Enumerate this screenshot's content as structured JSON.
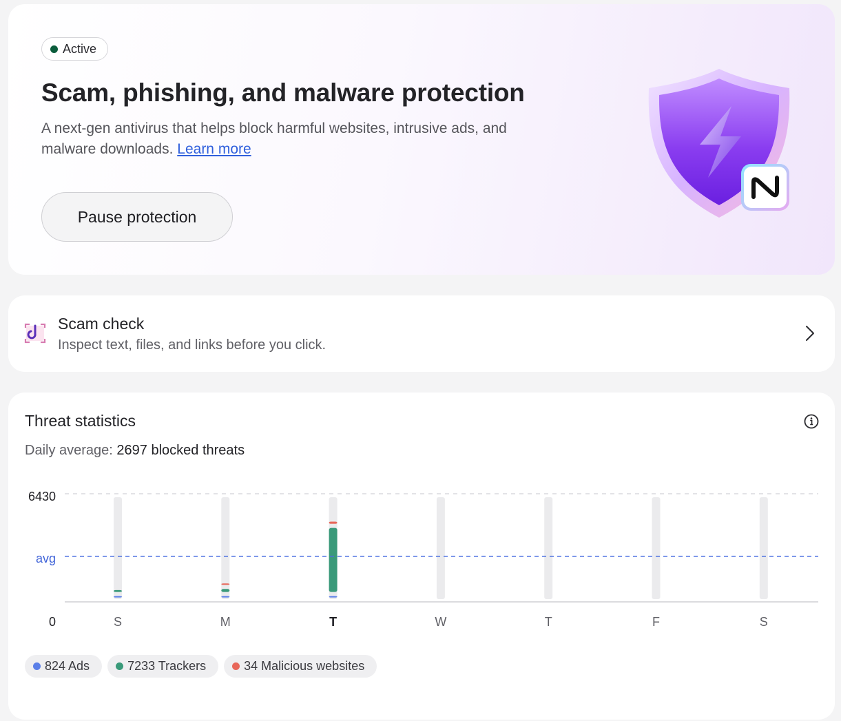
{
  "hero": {
    "status": "Active",
    "status_color": "#0b5d3c",
    "title": "Scam, phishing, and malware protection",
    "description": "A next-gen antivirus that helps block harmful websites, intrusive ads, and malware downloads.",
    "learn_more": "Learn more",
    "pause_button": "Pause protection",
    "shield_icon": "shield-lightning-icon",
    "badge_icon": "nordvpn-logo-icon"
  },
  "scam_check": {
    "title": "Scam check",
    "subtitle": "Inspect text, files, and links before you click.",
    "icon": "scan-hook-icon"
  },
  "threats": {
    "title": "Threat statistics",
    "daily_label": "Daily average:",
    "daily_value": "2697 blocked threats",
    "legend": [
      {
        "label": "824 Ads",
        "color": "#5b7fe8"
      },
      {
        "label": "7233 Trackers",
        "color": "#3a9a7a"
      },
      {
        "label": "34 Malicious websites",
        "color": "#e8675a"
      }
    ]
  },
  "chart_data": {
    "type": "bar",
    "stacked": true,
    "categories": [
      "S",
      "M",
      "T",
      "W",
      "T",
      "F",
      "S"
    ],
    "highlight_category_index": 2,
    "y_max_label": "6430",
    "y_min_label": "0",
    "avg_label": "avg",
    "ylim": [
      0,
      6430
    ],
    "avg_value": 2697,
    "series": [
      {
        "name": "Ads",
        "color": "#5b7fe8",
        "values": [
          320,
          320,
          320,
          0,
          0,
          0,
          0
        ]
      },
      {
        "name": "Trackers",
        "color": "#3a9a7a",
        "values": [
          380,
          450,
          4300,
          0,
          0,
          0,
          0
        ]
      },
      {
        "name": "Malicious websites",
        "color": "#e8675a",
        "values": [
          0,
          350,
          400,
          0,
          0,
          0,
          0
        ]
      }
    ]
  }
}
